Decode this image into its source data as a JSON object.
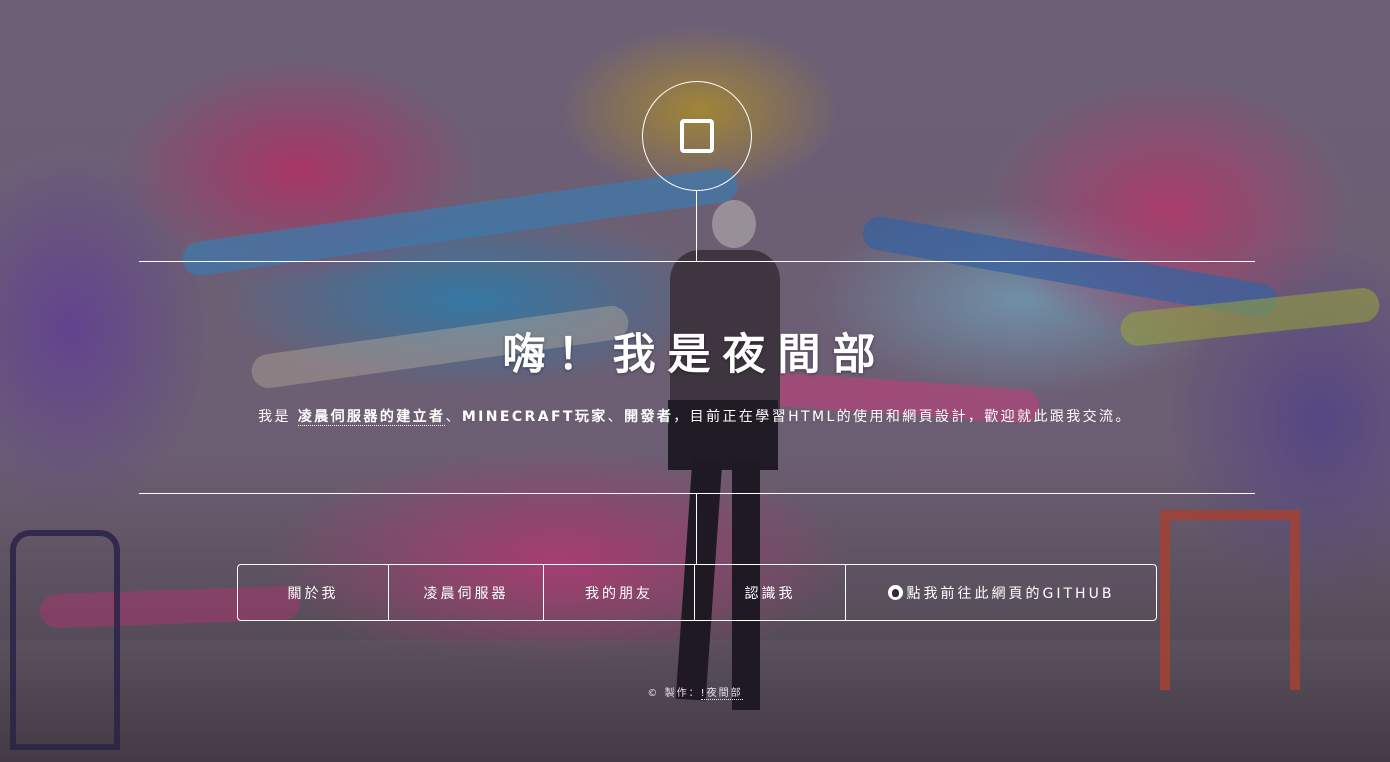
{
  "logo": {
    "icon": "square-outline-icon"
  },
  "hero": {
    "title": "嗨！我是夜間部"
  },
  "intro": {
    "prefix": "我是",
    "role1": "凌晨伺服器的建立者",
    "sep1": "、",
    "role2": "MINECRAFT玩家",
    "sep2": "、",
    "role3": "開發者",
    "suffix": "，目前正在學習HTML的使用和網頁設計，歡迎就此跟我交流。"
  },
  "nav": {
    "items": [
      {
        "label": "關於我"
      },
      {
        "label": "凌晨伺服器"
      },
      {
        "label": "我的朋友"
      },
      {
        "label": "認識我"
      },
      {
        "label": "點我前往此網頁的GITHUB",
        "icon": "github-icon"
      }
    ]
  },
  "footer": {
    "prefix": "© 製作：",
    "author": "!夜間部"
  },
  "colors": {
    "text": "#ffffff",
    "accent_line": "#ffffff"
  }
}
